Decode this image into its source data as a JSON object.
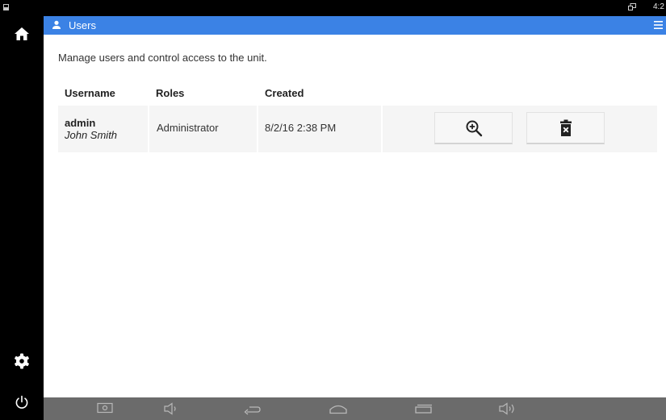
{
  "status_bar": {
    "time": "4:2"
  },
  "header": {
    "title": "Users"
  },
  "main": {
    "description": "Manage users and control access to the unit.",
    "table": {
      "columns": [
        "Username",
        "Roles",
        "Created"
      ],
      "rows": [
        {
          "username": "admin",
          "full_name": "John Smith",
          "role": "Administrator",
          "created": "8/2/16 2:38 PM"
        }
      ]
    }
  },
  "colors": {
    "accent": "#3b82e5",
    "row_background": "#f5f5f5",
    "nav_bar": "#6b6b6b"
  },
  "icons": {
    "sidebar": [
      "home-icon",
      "gear-icon",
      "power-icon"
    ],
    "row_actions": [
      "zoom-in-icon",
      "delete-icon"
    ],
    "nav_bar": [
      "screenshot-icon",
      "volume-down-icon",
      "back-icon",
      "home-nav-icon",
      "recents-icon",
      "volume-up-icon"
    ]
  }
}
